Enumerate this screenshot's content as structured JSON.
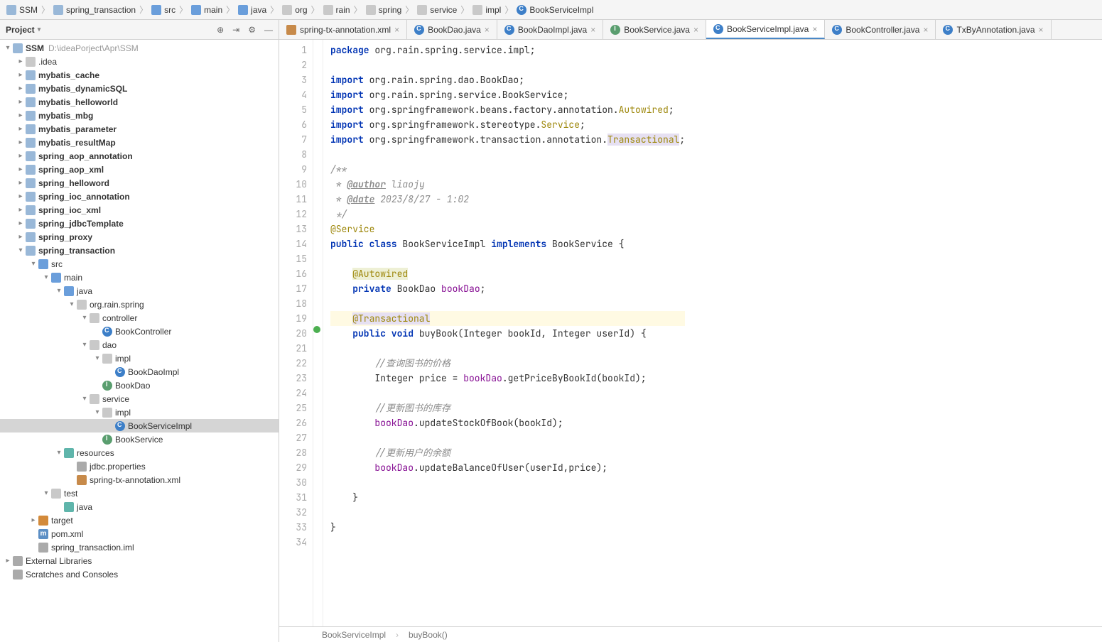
{
  "breadcrumb": [
    "SSM",
    "spring_transaction",
    "src",
    "main",
    "java",
    "org",
    "rain",
    "spring",
    "service",
    "impl",
    "BookServiceImpl"
  ],
  "breadcrumb_icons": [
    "mod",
    "mod",
    "folder blue",
    "folder blue",
    "folder blue",
    "folder",
    "folder",
    "folder",
    "folder",
    "folder",
    "class"
  ],
  "sidebar": {
    "title": "Project",
    "tree": [
      {
        "d": 0,
        "a": "open",
        "i": "mod",
        "t": "SSM",
        "dim": "D:\\ideaPorject\\Apr\\SSM",
        "bold": true
      },
      {
        "d": 1,
        "a": "closed",
        "i": "folder",
        "t": ".idea"
      },
      {
        "d": 1,
        "a": "closed",
        "i": "mod",
        "t": "mybatis_cache",
        "bold": true
      },
      {
        "d": 1,
        "a": "closed",
        "i": "mod",
        "t": "mybatis_dynamicSQL",
        "bold": true
      },
      {
        "d": 1,
        "a": "closed",
        "i": "mod",
        "t": "mybatis_helloworld",
        "bold": true
      },
      {
        "d": 1,
        "a": "closed",
        "i": "mod",
        "t": "mybatis_mbg",
        "bold": true
      },
      {
        "d": 1,
        "a": "closed",
        "i": "mod",
        "t": "mybatis_parameter",
        "bold": true
      },
      {
        "d": 1,
        "a": "closed",
        "i": "mod",
        "t": "mybatis_resultMap",
        "bold": true
      },
      {
        "d": 1,
        "a": "closed",
        "i": "mod",
        "t": "spring_aop_annotation",
        "bold": true
      },
      {
        "d": 1,
        "a": "closed",
        "i": "mod",
        "t": "spring_aop_xml",
        "bold": true
      },
      {
        "d": 1,
        "a": "closed",
        "i": "mod",
        "t": "spring_helloword",
        "bold": true
      },
      {
        "d": 1,
        "a": "closed",
        "i": "mod",
        "t": "spring_ioc_annotation",
        "bold": true
      },
      {
        "d": 1,
        "a": "closed",
        "i": "mod",
        "t": "spring_ioc_xml",
        "bold": true
      },
      {
        "d": 1,
        "a": "closed",
        "i": "mod",
        "t": "spring_jdbcTemplate",
        "bold": true
      },
      {
        "d": 1,
        "a": "closed",
        "i": "mod",
        "t": "spring_proxy",
        "bold": true
      },
      {
        "d": 1,
        "a": "open",
        "i": "mod",
        "t": "spring_transaction",
        "bold": true
      },
      {
        "d": 2,
        "a": "open",
        "i": "folder blue",
        "t": "src"
      },
      {
        "d": 3,
        "a": "open",
        "i": "folder blue",
        "t": "main"
      },
      {
        "d": 4,
        "a": "open",
        "i": "folder blue",
        "t": "java"
      },
      {
        "d": 5,
        "a": "open",
        "i": "folder",
        "t": "org.rain.spring"
      },
      {
        "d": 6,
        "a": "open",
        "i": "folder",
        "t": "controller"
      },
      {
        "d": 7,
        "a": "none",
        "i": "class",
        "t": "BookController"
      },
      {
        "d": 6,
        "a": "open",
        "i": "folder",
        "t": "dao"
      },
      {
        "d": 7,
        "a": "open",
        "i": "folder",
        "t": "impl"
      },
      {
        "d": 8,
        "a": "none",
        "i": "class",
        "t": "BookDaoImpl"
      },
      {
        "d": 7,
        "a": "none",
        "i": "intf",
        "t": "BookDao"
      },
      {
        "d": 6,
        "a": "open",
        "i": "folder",
        "t": "service"
      },
      {
        "d": 7,
        "a": "open",
        "i": "folder",
        "t": "impl"
      },
      {
        "d": 8,
        "a": "none",
        "i": "class",
        "t": "BookServiceImpl",
        "sel": true
      },
      {
        "d": 7,
        "a": "none",
        "i": "intf",
        "t": "BookService"
      },
      {
        "d": 4,
        "a": "open",
        "i": "folder teal",
        "t": "resources"
      },
      {
        "d": 5,
        "a": "none",
        "i": "file",
        "t": "jdbc.properties"
      },
      {
        "d": 5,
        "a": "none",
        "i": "xml",
        "t": "spring-tx-annotation.xml"
      },
      {
        "d": 3,
        "a": "open",
        "i": "folder",
        "t": "test"
      },
      {
        "d": 4,
        "a": "none",
        "i": "folder teal",
        "t": "java"
      },
      {
        "d": 2,
        "a": "closed",
        "i": "folder orange",
        "t": "target"
      },
      {
        "d": 2,
        "a": "none",
        "i": "m",
        "t": "pom.xml"
      },
      {
        "d": 2,
        "a": "none",
        "i": "file",
        "t": "spring_transaction.iml"
      },
      {
        "d": 0,
        "a": "closed",
        "i": "file",
        "t": "External Libraries"
      },
      {
        "d": 0,
        "a": "none",
        "i": "file",
        "t": "Scratches and Consoles"
      }
    ]
  },
  "tabs": [
    {
      "label": "spring-tx-annotation.xml",
      "icon": "xml"
    },
    {
      "label": "BookDao.java",
      "icon": "class"
    },
    {
      "label": "BookDaoImpl.java",
      "icon": "class"
    },
    {
      "label": "BookService.java",
      "icon": "intf"
    },
    {
      "label": "BookServiceImpl.java",
      "icon": "class",
      "active": true
    },
    {
      "label": "BookController.java",
      "icon": "class"
    },
    {
      "label": "TxByAnnotation.java",
      "icon": "class"
    }
  ],
  "code": {
    "lines": [
      [
        {
          "t": "package ",
          "c": "kw"
        },
        {
          "t": "org.rain.spring.service.impl;"
        }
      ],
      [],
      [
        {
          "t": "import ",
          "c": "kw"
        },
        {
          "t": "org.rain.spring.dao.BookDao;"
        }
      ],
      [
        {
          "t": "import ",
          "c": "kw"
        },
        {
          "t": "org.rain.spring.service.BookService;"
        }
      ],
      [
        {
          "t": "import ",
          "c": "kw"
        },
        {
          "t": "org.springframework.beans.factory.annotation."
        },
        {
          "t": "Autowired",
          "c": "ann"
        },
        {
          "t": ";"
        }
      ],
      [
        {
          "t": "import ",
          "c": "kw"
        },
        {
          "t": "org.springframework.stereotype."
        },
        {
          "t": "Service",
          "c": "ann"
        },
        {
          "t": ";"
        }
      ],
      [
        {
          "t": "import ",
          "c": "kw"
        },
        {
          "t": "org.springframework.transaction.annotation."
        },
        {
          "t": "Transactional",
          "c": "ann ref-hl"
        },
        {
          "t": ";"
        }
      ],
      [],
      [
        {
          "t": "/**",
          "c": "com"
        }
      ],
      [
        {
          "t": " * ",
          "c": "com"
        },
        {
          "t": "@author",
          "c": "doc-tag"
        },
        {
          "t": " liaojy",
          "c": "com"
        }
      ],
      [
        {
          "t": " * ",
          "c": "com"
        },
        {
          "t": "@date",
          "c": "doc-tag"
        },
        {
          "t": " 2023/8/27 - 1:02",
          "c": "com"
        }
      ],
      [
        {
          "t": " */",
          "c": "com"
        }
      ],
      [
        {
          "t": "@Service",
          "c": "ann"
        }
      ],
      [
        {
          "t": "public class ",
          "c": "kw"
        },
        {
          "t": "BookServiceImpl "
        },
        {
          "t": "implements ",
          "c": "kw"
        },
        {
          "t": "BookService {"
        }
      ],
      [],
      [
        {
          "t": "    "
        },
        {
          "t": "@Autowired",
          "c": "ann ann-bg"
        }
      ],
      [
        {
          "t": "    "
        },
        {
          "t": "private ",
          "c": "kw"
        },
        {
          "t": "BookDao "
        },
        {
          "t": "bookDao",
          "c": "fld"
        },
        {
          "t": ";"
        }
      ],
      [],
      [
        {
          "t": "    "
        },
        {
          "t": "@Transactional",
          "c": "ann ref-hl"
        }
      ],
      [
        {
          "t": "    "
        },
        {
          "t": "public void ",
          "c": "kw"
        },
        {
          "t": "buyBook(Integer bookId, Integer userId) {"
        }
      ],
      [],
      [
        {
          "t": "        "
        },
        {
          "t": "//查询图书的价格",
          "c": "com"
        }
      ],
      [
        {
          "t": "        Integer price = "
        },
        {
          "t": "bookDao",
          "c": "fld"
        },
        {
          "t": ".getPriceByBookId(bookId);"
        }
      ],
      [],
      [
        {
          "t": "        "
        },
        {
          "t": "//更新图书的库存",
          "c": "com"
        }
      ],
      [
        {
          "t": "        "
        },
        {
          "t": "bookDao",
          "c": "fld"
        },
        {
          "t": ".updateStockOfBook(bookId);"
        }
      ],
      [],
      [
        {
          "t": "        "
        },
        {
          "t": "//更新用户的余额",
          "c": "com"
        }
      ],
      [
        {
          "t": "        "
        },
        {
          "t": "bookDao",
          "c": "fld"
        },
        {
          "t": ".updateBalanceOfUser(userId,price);"
        }
      ],
      [],
      [
        {
          "t": "    }"
        }
      ],
      [],
      [
        {
          "t": "}"
        }
      ],
      []
    ],
    "highlight_line": 19,
    "marks": {
      "20": "impl"
    }
  },
  "status": {
    "cls": "BookServiceImpl",
    "meth": "buyBook()"
  }
}
